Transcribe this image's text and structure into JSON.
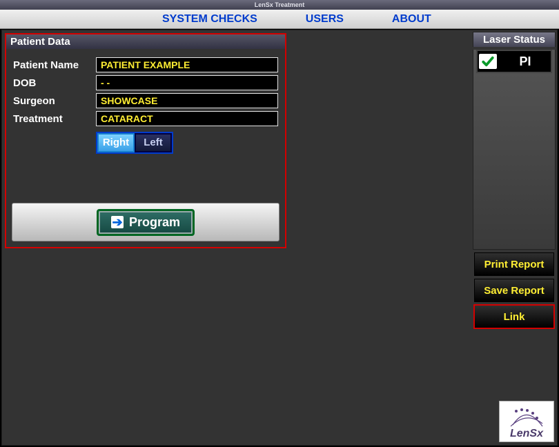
{
  "window_title": "LenSx Treatment",
  "menubar": {
    "system_checks": "SYSTEM CHECKS",
    "users": "USERS",
    "about": "ABOUT"
  },
  "patient_panel": {
    "title": "Patient Data",
    "labels": {
      "name": "Patient Name",
      "dob": "DOB",
      "surgeon": "Surgeon",
      "treatment": "Treatment"
    },
    "values": {
      "name": "PATIENT EXAMPLE",
      "dob": "  -  -",
      "surgeon": "SHOWCASE",
      "treatment": "CATARACT"
    },
    "eye": {
      "right": "Right",
      "left": "Left",
      "selected": "Right"
    },
    "program_btn": "Program"
  },
  "laser_status": {
    "title": "Laser Status",
    "pi": "PI"
  },
  "side_buttons": {
    "print": "Print Report",
    "save": "Save Report",
    "link": "Link"
  },
  "logo_text": "LenSx"
}
